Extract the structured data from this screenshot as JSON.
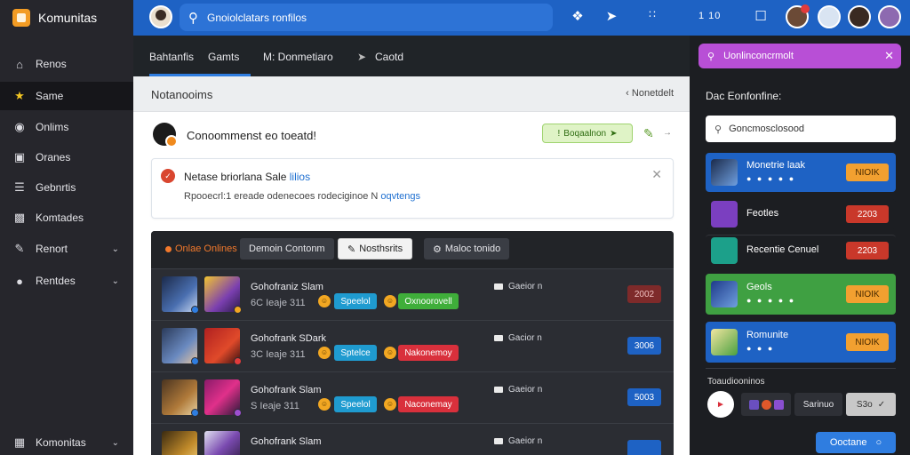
{
  "app": {
    "name": "Komunitas"
  },
  "sidebar": {
    "items": [
      {
        "label": "Renos",
        "icon": "home-icon"
      },
      {
        "label": "Same",
        "icon": "star-icon"
      },
      {
        "label": "Onlims",
        "icon": "globe-icon"
      },
      {
        "label": "Oranes",
        "icon": "box-icon"
      },
      {
        "label": "Gebnrtis",
        "icon": "list-icon"
      },
      {
        "label": "Komtades",
        "icon": "folder-icon"
      },
      {
        "label": "Renort",
        "icon": "pen-icon"
      },
      {
        "label": "Rentdes",
        "icon": "location-icon"
      }
    ],
    "footer": "Komonitas"
  },
  "topbar": {
    "search_text": "Gnoiolclatars ronfilos",
    "counter": "1 10"
  },
  "subnav": {
    "tabs": [
      "Bahtanfis",
      "Gamts",
      "M: Donmetiaro",
      "Caotd"
    ]
  },
  "notifications": {
    "title": "Notanooims",
    "back_label": "Nonetdelt"
  },
  "post": {
    "text": "Conoommenst eo toeatd!",
    "pill": "Boqaalnon",
    "arrow": "→"
  },
  "alert": {
    "title": "Netase briorlana Sale",
    "title_link": "lilios",
    "body": "Rpooecrl:1 ereade odenecoes rodeciginoe N",
    "body_link": "oqvtengs"
  },
  "panel": {
    "tabs": [
      "Onlae Onlines",
      "Demoin Contonm",
      "Nosthsrits",
      "Maloc tonido"
    ],
    "rows": [
      {
        "name": "Gohofraniz Slam",
        "meta": "6C Ieaje 311",
        "tag1": "Speelol",
        "tag2": "Oxnoorovell",
        "right": "Gaeior n",
        "num": "2002"
      },
      {
        "name": "Gohofrank SDark",
        "meta": "3C Ieaje 311",
        "tag1": "Sptelce",
        "tag2": "Nakonemoy",
        "right": "Gacior n",
        "num": "3006"
      },
      {
        "name": "Gohofrank Slam",
        "meta": "S Ieaje 311",
        "tag1": "Speelol",
        "tag2": "Naconemay",
        "right": "Gaeior n",
        "num": "5003"
      },
      {
        "name": "Gohofrank Slam",
        "meta": "",
        "tag1": "",
        "tag2": "",
        "right": "Gaeior n",
        "num": ""
      }
    ]
  },
  "right": {
    "search_text": "Uonlinconcrmolt",
    "heading": "Dac Eonfonfine:",
    "input_text": "Goncmosclosood",
    "cards": [
      {
        "title": "Monetrie laak",
        "button": "NIOIK",
        "dots": "● ● ● ● ●"
      },
      {
        "title": "Feotles",
        "button": "2203"
      },
      {
        "title": "Recentie Cenuel",
        "button": "2203"
      },
      {
        "title": "Geols",
        "button": "NIOIK",
        "dots": "● ● ● ● ●"
      },
      {
        "title": "Romunite",
        "button": "NIOIK",
        "dots": "● ● ●"
      }
    ],
    "sub_label": "Toaudiooninos",
    "bottom_buttons": [
      "Sarinuo",
      "S3o"
    ],
    "cta": "Ooctane"
  }
}
